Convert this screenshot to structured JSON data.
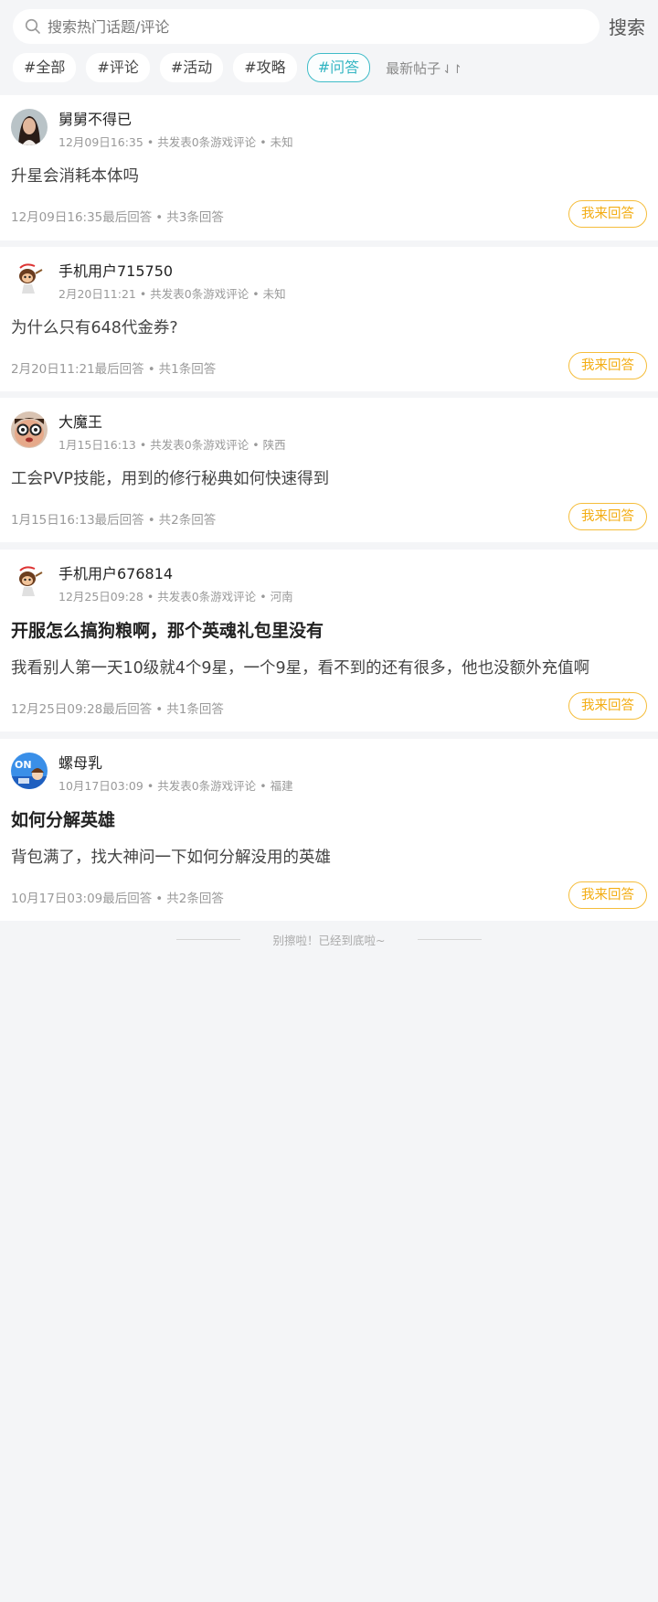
{
  "search": {
    "placeholder": "搜索热门话题/评论",
    "value": "",
    "button_label": "搜索"
  },
  "tags": [
    {
      "label": "#全部",
      "active": false
    },
    {
      "label": "#评论",
      "active": false
    },
    {
      "label": "#活动",
      "active": false
    },
    {
      "label": "#攻略",
      "active": false
    },
    {
      "label": "#问答",
      "active": true
    }
  ],
  "sort": {
    "label": "最新帖子",
    "icon": "sort-arrows-icon"
  },
  "colors": {
    "accent": "#3fbcc8",
    "answer_button": "#f3ad14",
    "page_background": "#f4f5f7"
  },
  "posts": [
    {
      "username": "舅舅不得已",
      "avatar": "portrait-woman-avatar",
      "time": "12月09日16:35",
      "stats": "共发表0条游戏评论",
      "region": "未知",
      "title": "",
      "content": "升星会消耗本体吗",
      "last_answer": "12月09日16:35最后回答",
      "reply_count": "共3条回答",
      "answer_label": "我来回答"
    },
    {
      "username": "手机用户715750",
      "avatar": "monkey-cartoon-avatar",
      "time": "2月20日11:21",
      "stats": "共发表0条游戏评论",
      "region": "未知",
      "title": "",
      "content": "为什么只有648代金券?",
      "last_answer": "2月20日11:21最后回答",
      "reply_count": "共1条回答",
      "answer_label": "我来回答"
    },
    {
      "username": "大魔王",
      "avatar": "glasses-face-avatar",
      "time": "1月15日16:13",
      "stats": "共发表0条游戏评论",
      "region": "陕西",
      "title": "",
      "content": "工会PVP技能，用到的修行秘典如何快速得到",
      "last_answer": "1月15日16:13最后回答",
      "reply_count": "共2条回答",
      "answer_label": "我来回答"
    },
    {
      "username": "手机用户676814",
      "avatar": "monkey-cartoon-avatar",
      "time": "12月25日09:28",
      "stats": "共发表0条游戏评论",
      "region": "河南",
      "title": "开服怎么搞狗粮啊，那个英魂礼包里没有",
      "content": "我看别人第一天10级就4个9星，一个9星，看不到的还有很多，他也没额外充值啊",
      "last_answer": "12月25日09:28最后回答",
      "reply_count": "共1条回答",
      "answer_label": "我来回答"
    },
    {
      "username": "螺母乳",
      "avatar": "blue-game-avatar",
      "time": "10月17日03:09",
      "stats": "共发表0条游戏评论",
      "region": "福建",
      "title": "如何分解英雄",
      "content": "背包满了，找大神问一下如何分解没用的英雄",
      "last_answer": "10月17日03:09最后回答",
      "reply_count": "共2条回答",
      "answer_label": "我来回答"
    }
  ],
  "end_text": "别擦啦！已经到底啦~"
}
